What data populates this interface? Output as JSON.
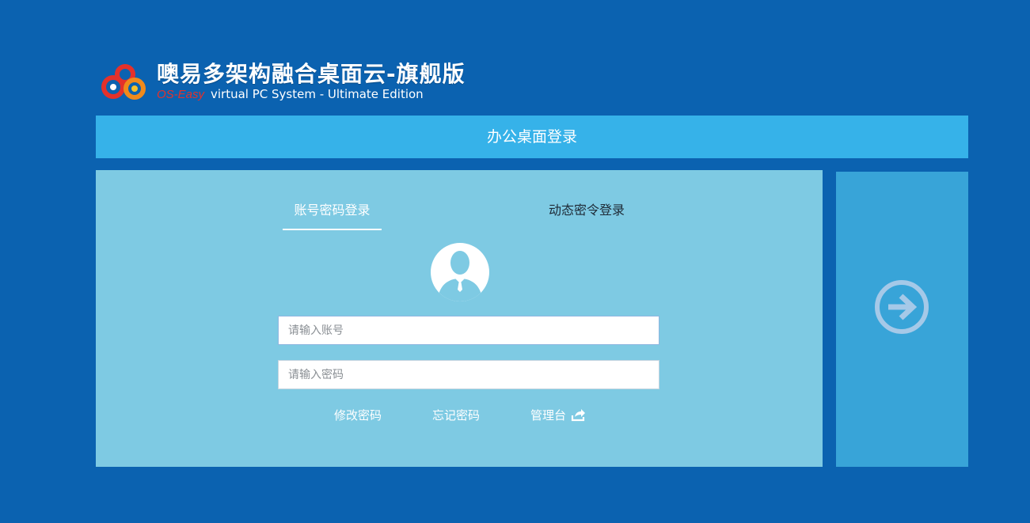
{
  "header": {
    "logo_icon": "three-ring-logo-icon",
    "title": "噢易多架构融合桌面云-旗舰版",
    "brand": "OS-Easy",
    "subtitle": "virtual PC System - Ultimate Edition",
    "brand_color": "#e4312b"
  },
  "banner": {
    "title": "办公桌面登录",
    "color": "#36b2e9"
  },
  "login": {
    "tabs": [
      {
        "label": "账号密码登录",
        "active": true
      },
      {
        "label": "动态密令登录",
        "active": false
      }
    ],
    "avatar_icon": "user-avatar-icon",
    "account": {
      "value": "",
      "placeholder": "请输入账号"
    },
    "password": {
      "value": "",
      "placeholder": "请输入密码"
    },
    "links": {
      "change_password": "修改密码",
      "forgot_password": "忘记密码",
      "admin_console": "管理台",
      "admin_icon": "share-icon"
    },
    "submit_icon": "arrow-right-circle-icon"
  },
  "colors": {
    "background": "#0b62b0",
    "panel": "#7ecae3",
    "submit_panel": "#38a4d8"
  }
}
